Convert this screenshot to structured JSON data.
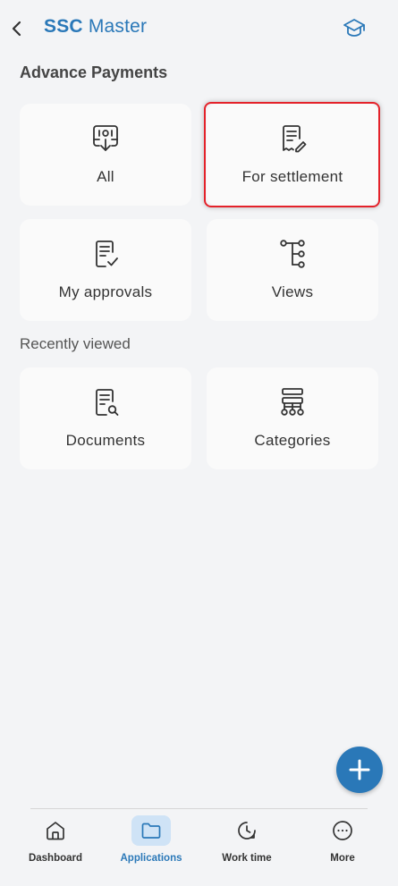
{
  "header": {
    "title_brand": "SSC",
    "title_rest": " Master"
  },
  "section": {
    "title": "Advance Payments",
    "recent_title": "Recently viewed"
  },
  "tiles": [
    {
      "label": "All",
      "icon": "inbox-tray-icon"
    },
    {
      "label": "For settlement",
      "icon": "document-edit-icon"
    },
    {
      "label": "My approvals",
      "icon": "document-check-icon"
    },
    {
      "label": "Views",
      "icon": "tree-structure-icon"
    }
  ],
  "recent": [
    {
      "label": "Documents",
      "icon": "document-search-icon"
    },
    {
      "label": "Categories",
      "icon": "hierarchy-icon"
    }
  ],
  "nav": [
    {
      "label": "Dashboard",
      "icon": "home-icon"
    },
    {
      "label": "Applications",
      "icon": "folder-icon",
      "active": true
    },
    {
      "label": "Work time",
      "icon": "clock-icon"
    },
    {
      "label": "More",
      "icon": "more-dots-icon"
    }
  ],
  "colors": {
    "accent": "#2a78b8",
    "highlight": "#e4222a",
    "background": "#f3f4f6"
  }
}
